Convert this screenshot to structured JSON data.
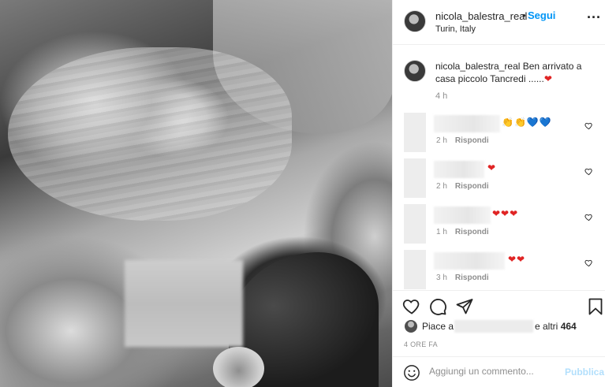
{
  "header": {
    "username": "nicola_balestra_real",
    "separator": "•",
    "follow_label": "Segui",
    "location": "Turin, Italy",
    "more_label": "..."
  },
  "caption": {
    "username": "nicola_balestra_real",
    "text": "Ben arrivato a casa piccolo Tancredi ......",
    "emoji": "❤",
    "time": "4 h"
  },
  "comments": [
    {
      "emojis": "👏👏💙💙",
      "time": "2 h",
      "reply": "Rispondi"
    },
    {
      "emojis": "❤",
      "time": "2 h",
      "reply": "Rispondi"
    },
    {
      "emojis": "❤❤❤",
      "time": "1 h",
      "reply": "Rispondi"
    },
    {
      "emojis": "❤❤",
      "time": "3 h",
      "reply": "Rispondi"
    }
  ],
  "likes": {
    "liked_by_prefix": "Piace a",
    "others_prefix": "e altri",
    "count": "464"
  },
  "post_time": "4 ORE FA",
  "composer": {
    "placeholder": "Aggiungi un commento...",
    "publish_label": "Pubblica"
  },
  "colors": {
    "accent": "#0095f6",
    "publish_disabled": "#b2dffc",
    "heart": "#e02424",
    "text": "#262626",
    "secondary_text": "#8e8e8e"
  },
  "icons": [
    "heart-icon",
    "comment-icon",
    "share-icon",
    "bookmark-icon",
    "emoji-icon",
    "more-options-icon",
    "like-comment-icon"
  ]
}
